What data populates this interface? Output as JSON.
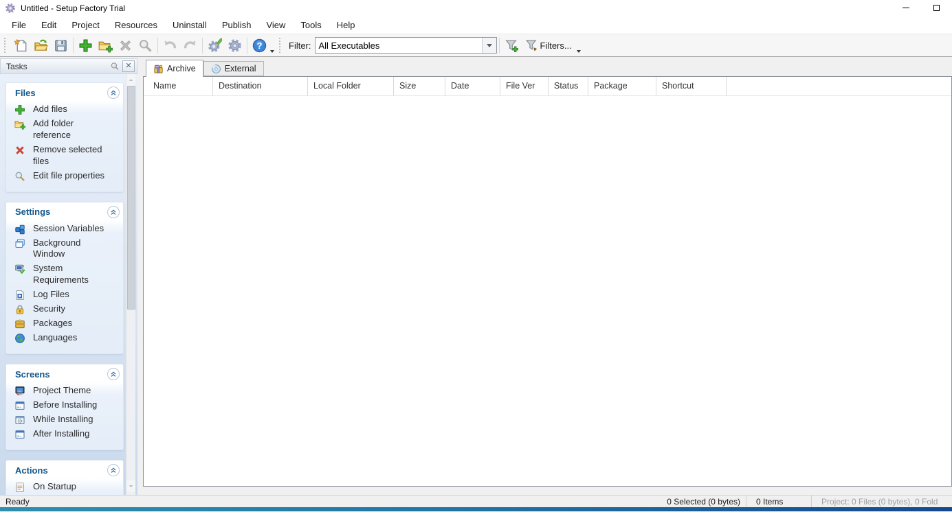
{
  "window": {
    "title": "Untitled - Setup Factory Trial"
  },
  "menu": {
    "items": [
      "File",
      "Edit",
      "Project",
      "Resources",
      "Uninstall",
      "Publish",
      "View",
      "Tools",
      "Help"
    ]
  },
  "toolbar": {
    "buttons": [
      {
        "icon": "new-document-icon"
      },
      {
        "icon": "open-folder-icon"
      },
      {
        "icon": "save-icon"
      },
      {
        "icon": "add-files-icon"
      },
      {
        "icon": "add-folder-icon"
      },
      {
        "icon": "remove-icon",
        "disabled": true
      },
      {
        "icon": "magnifier-icon",
        "disabled": true
      },
      {
        "icon": "undo-icon",
        "disabled": true
      },
      {
        "icon": "redo-icon",
        "disabled": true
      },
      {
        "icon": "gear-edit-icon"
      },
      {
        "icon": "gear-icon"
      },
      {
        "icon": "help-icon"
      }
    ],
    "filter_label": "Filter:",
    "filter_value": "All Executables",
    "add_filter_icon": "funnel-add-icon",
    "filters_button_label": "Filters..."
  },
  "tasks_panel": {
    "title": "Tasks",
    "sections": [
      {
        "title": "Files",
        "items": [
          {
            "icon": "add-files-icon",
            "label": "Add files"
          },
          {
            "icon": "add-folder-icon",
            "label": "Add folder reference"
          },
          {
            "icon": "remove-files-icon",
            "label": "Remove selected files"
          },
          {
            "icon": "edit-properties-icon",
            "label": "Edit file properties"
          }
        ]
      },
      {
        "title": "Settings",
        "items": [
          {
            "icon": "session-variables-icon",
            "label": "Session Variables"
          },
          {
            "icon": "background-window-icon",
            "label": "Background Window"
          },
          {
            "icon": "system-requirements-icon",
            "label": "System Requirements"
          },
          {
            "icon": "log-files-icon",
            "label": "Log Files"
          },
          {
            "icon": "security-icon",
            "label": "Security"
          },
          {
            "icon": "packages-icon",
            "label": "Packages"
          },
          {
            "icon": "languages-icon",
            "label": "Languages"
          }
        ]
      },
      {
        "title": "Screens",
        "items": [
          {
            "icon": "project-theme-icon",
            "label": "Project Theme"
          },
          {
            "icon": "before-installing-icon",
            "label": "Before Installing"
          },
          {
            "icon": "while-installing-icon",
            "label": "While Installing"
          },
          {
            "icon": "after-installing-icon",
            "label": "After Installing"
          }
        ]
      },
      {
        "title": "Actions",
        "items": [
          {
            "icon": "on-startup-icon",
            "label": "On Startup"
          }
        ]
      }
    ]
  },
  "main": {
    "tabs": [
      {
        "icon": "archive-icon",
        "label": "Archive",
        "active": true
      },
      {
        "icon": "cd-icon",
        "label": "External",
        "active": false
      }
    ],
    "columns": [
      "Name",
      "Destination",
      "Local Folder",
      "Size",
      "Date",
      "File Ver",
      "Status",
      "Package",
      "Shortcut"
    ],
    "rows": []
  },
  "status_bar": {
    "ready": "Ready",
    "selected": "0 Selected (0 bytes)",
    "items_count": "0 Items",
    "project": "Project: 0 Files (0 bytes), 0 Fold"
  },
  "colors": {
    "section_title": "#11568c",
    "panel_gradient_top": "#e9f0f9",
    "panel_gradient_bottom": "#c9d9ec",
    "taskbar_strip_left": "#2e8fae",
    "taskbar_strip_right": "#15498f"
  }
}
